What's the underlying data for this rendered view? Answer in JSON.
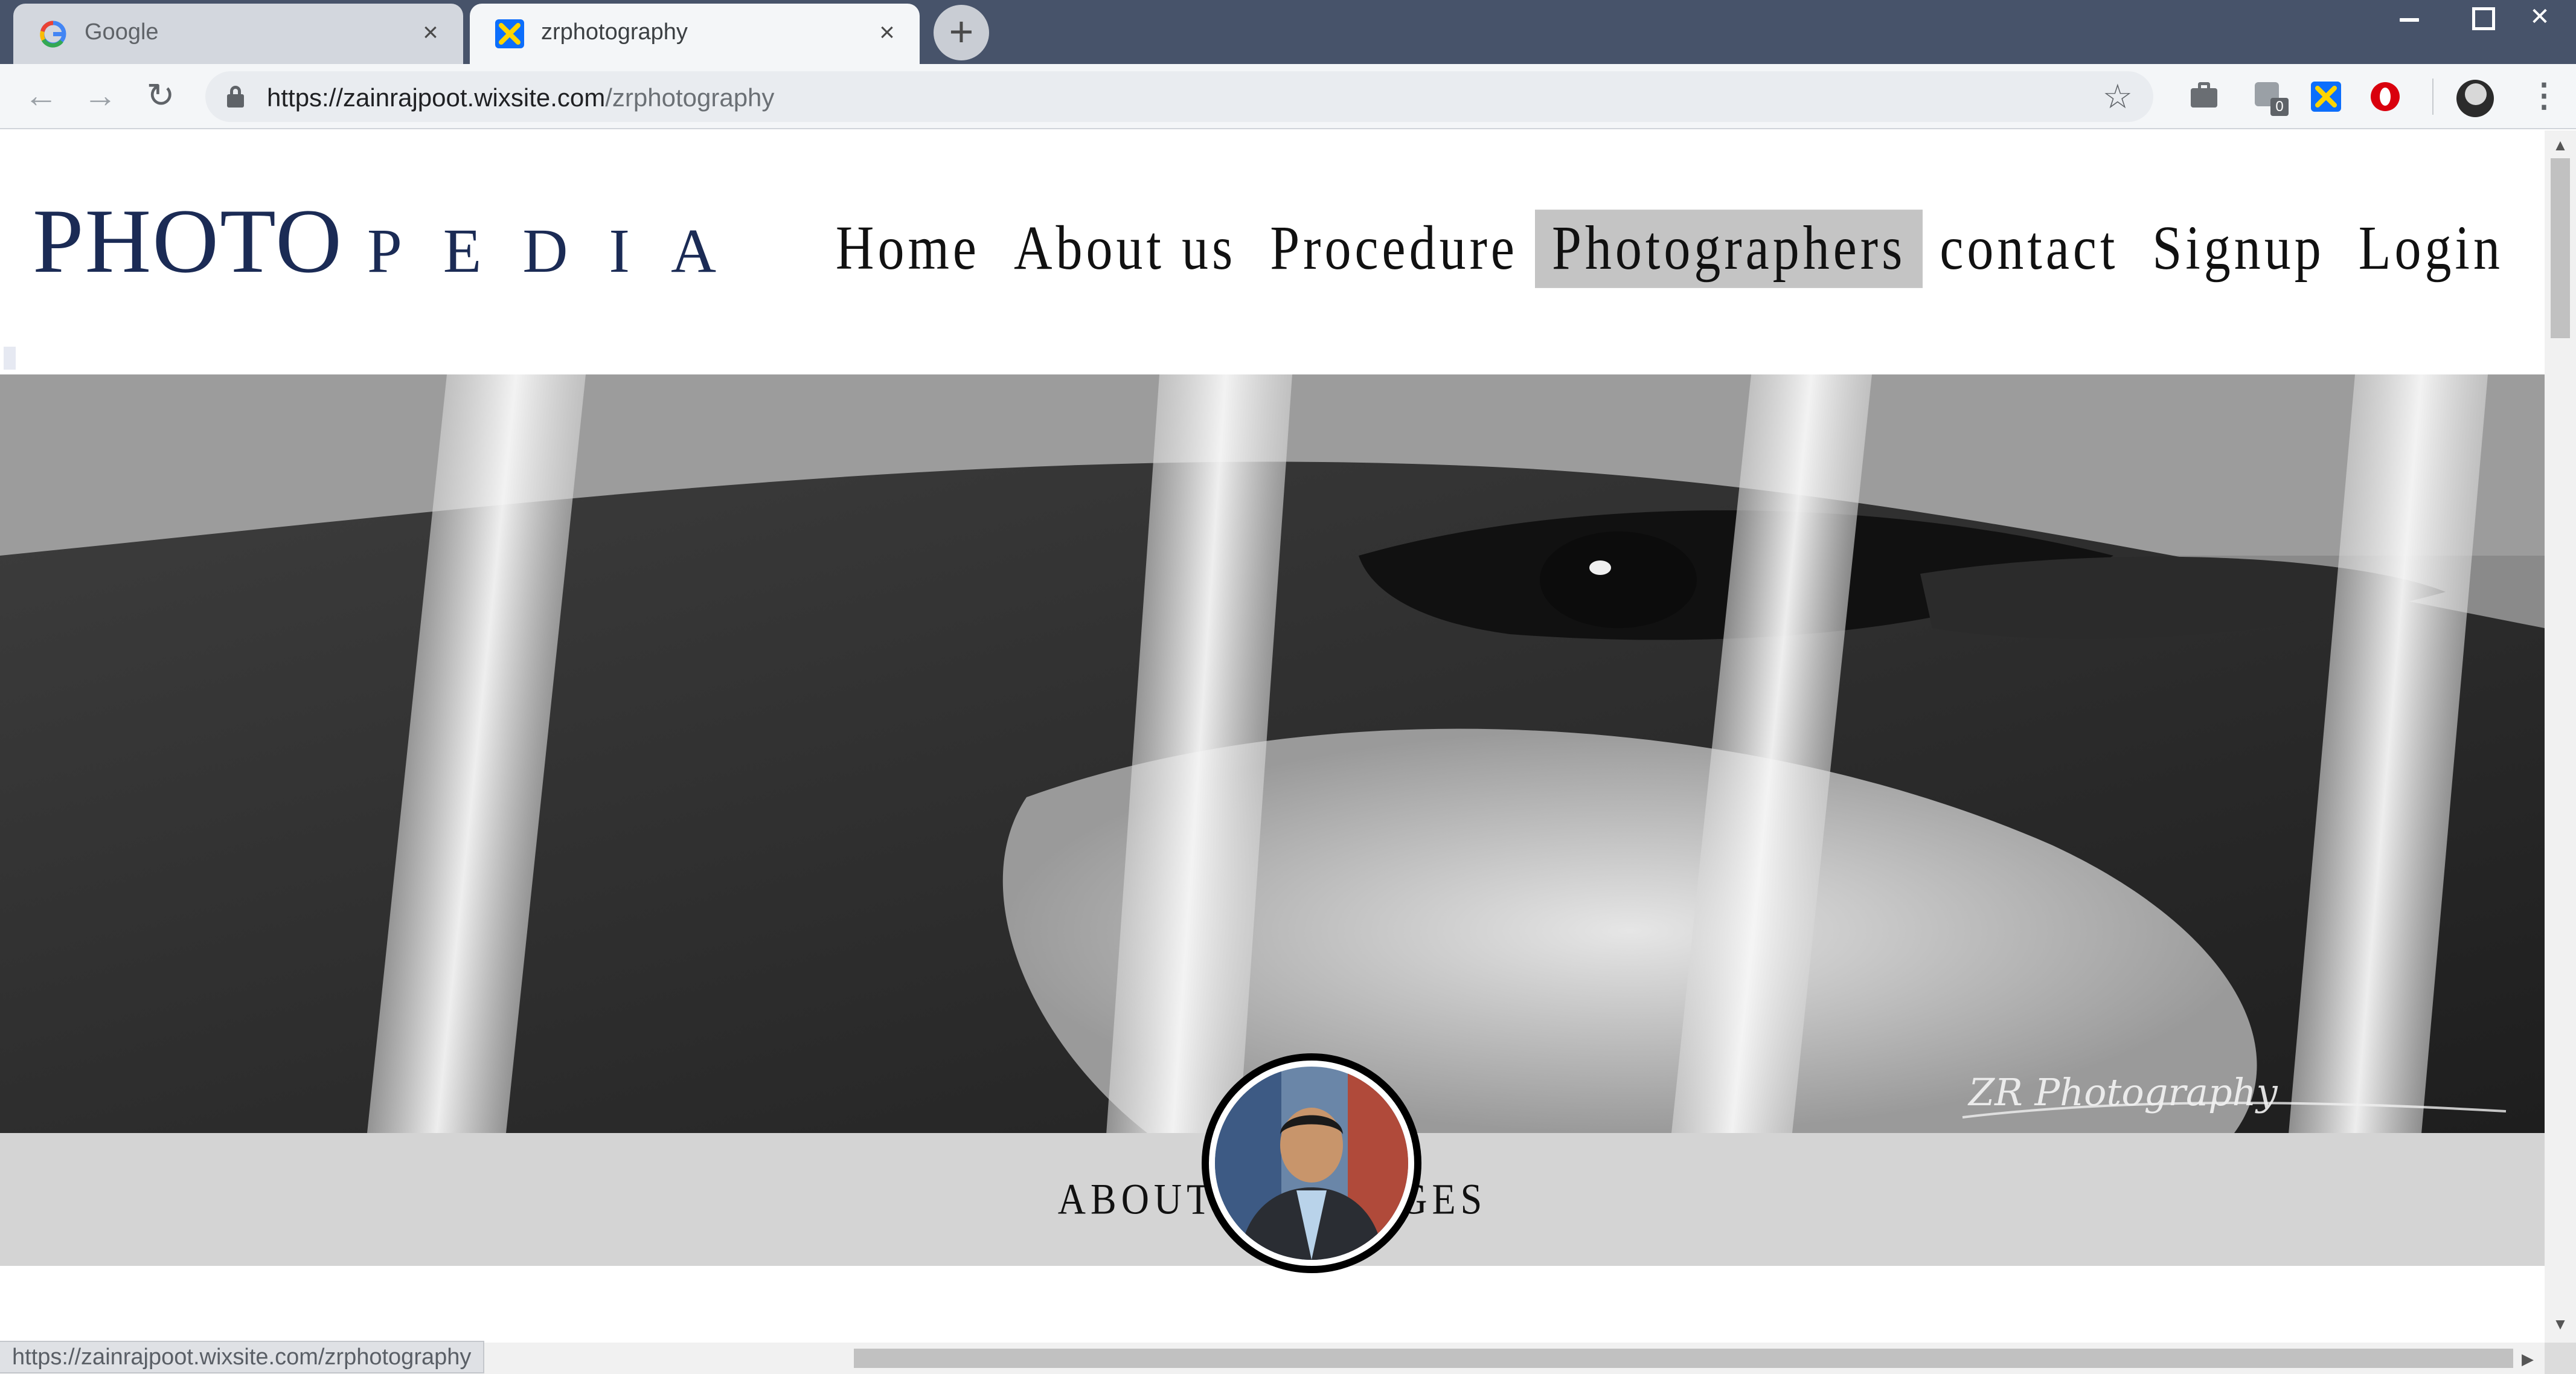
{
  "browser": {
    "tabs": [
      {
        "title": "Google",
        "active": false
      },
      {
        "title": "zrphotography",
        "active": true
      }
    ],
    "url_host": "https://zainrajpoot.wixsite.com",
    "url_path": "/zrphotography",
    "extension_badge": "0",
    "status_url": "https://zainrajpoot.wixsite.com/zrphotography"
  },
  "site": {
    "logo_main": "PHOTO",
    "logo_sub": "PEDIA",
    "nav": [
      "Home",
      "About us",
      "Procedure",
      "Photographers",
      "contact",
      "Signup",
      "Login"
    ],
    "active_nav_index": 3,
    "hero_watermark": "ZR Photography",
    "subnav": [
      "ABOUT",
      "PACKAGES"
    ]
  },
  "colors": {
    "logo": "#1b2b55",
    "active_nav_bg": "#c4c4c4",
    "subnav_bg": "#d4d4d4"
  }
}
